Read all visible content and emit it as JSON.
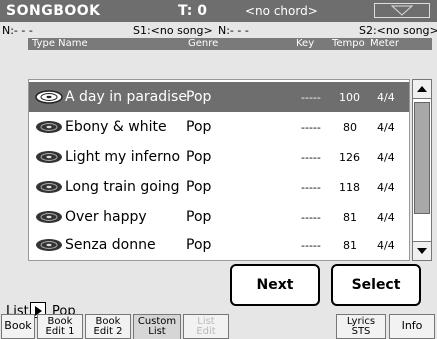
{
  "header": {
    "title": "SONGBOOK",
    "tempo": "T: 0",
    "chord": "<no chord>",
    "menu_icon": "down-triangle"
  },
  "status": {
    "n1": "N:- - -",
    "s1": "S1:<no song>",
    "n2": "N:- - -",
    "s2": "S2:<no song>"
  },
  "columns": {
    "type_name": "Type Name",
    "genre": "Genre",
    "key": "Key",
    "tempo": "Tempo",
    "meter": "Meter"
  },
  "songs": [
    {
      "name": "A day in paradise",
      "genre": "Pop",
      "key": "-----",
      "tempo": "100",
      "meter": "4/4"
    },
    {
      "name": "Ebony & white",
      "genre": "Pop",
      "key": "-----",
      "tempo": "80",
      "meter": "4/4"
    },
    {
      "name": "Light my inferno",
      "genre": "Pop",
      "key": "-----",
      "tempo": "126",
      "meter": "4/4"
    },
    {
      "name": "Long train going",
      "genre": "Pop",
      "key": "-----",
      "tempo": "118",
      "meter": "4/4"
    },
    {
      "name": "Over happy",
      "genre": "Pop",
      "key": "-----",
      "tempo": "81",
      "meter": "4/4"
    },
    {
      "name": "Senza donne",
      "genre": "Pop",
      "key": "-----",
      "tempo": "81",
      "meter": "4/4"
    }
  ],
  "list_filter": {
    "label": "List:",
    "value": "Pop"
  },
  "buttons": {
    "next": "Next",
    "select": "Select"
  },
  "tabs": {
    "book": "Book",
    "book_edit1_a": "Book",
    "book_edit1_b": "Edit 1",
    "book_edit2_a": "Book",
    "book_edit2_b": "Edit 2",
    "custom_list_a": "Custom",
    "custom_list_b": "List",
    "list_edit_a": "List",
    "list_edit_b": "Edit",
    "lyrics_sts_a": "Lyrics",
    "lyrics_sts_b": "STS",
    "info": "Info"
  },
  "colors": {
    "selected_row": "#6e6e6e",
    "titlebar": "#6e6e6e",
    "background": "#e6e6e6"
  }
}
